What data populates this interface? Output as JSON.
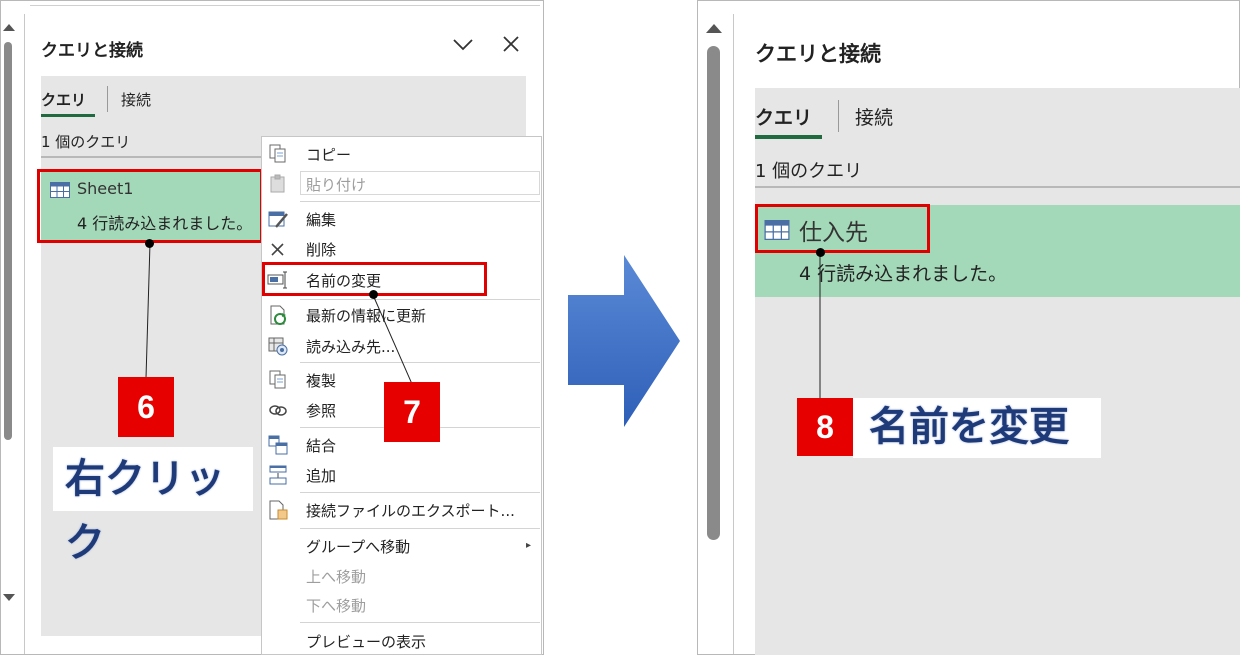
{
  "left_panel": {
    "title": "クエリと接続",
    "tabs": {
      "queries": "クエリ",
      "connections": "接続"
    },
    "query_count": "1 個のクエリ",
    "query": {
      "name": "Sheet1",
      "status": "4 行読み込まれました。"
    }
  },
  "context_menu": {
    "items": [
      {
        "label": "コピー",
        "icon": "copy-icon"
      },
      {
        "label": "貼り付け",
        "icon": "paste-icon",
        "disabled": true
      },
      {
        "label": "編集",
        "icon": "edit-icon"
      },
      {
        "label": "削除",
        "icon": "delete-icon"
      },
      {
        "label": "名前の変更",
        "icon": "rename-icon"
      },
      {
        "label": "最新の情報に更新",
        "icon": "refresh-icon"
      },
      {
        "label": "読み込み先...",
        "icon": "load-to-icon"
      },
      {
        "label": "複製",
        "icon": "duplicate-icon"
      },
      {
        "label": "参照",
        "icon": "reference-icon"
      },
      {
        "label": "結合",
        "icon": "merge-icon"
      },
      {
        "label": "追加",
        "icon": "append-icon"
      },
      {
        "label": "接続ファイルのエクスポート...",
        "icon": "export-icon"
      },
      {
        "label": "グループへ移動",
        "icon": ""
      },
      {
        "label": "上へ移動",
        "icon": "",
        "disabled": true
      },
      {
        "label": "下へ移動",
        "icon": "",
        "disabled": true
      },
      {
        "label": "プレビューの表示",
        "icon": ""
      }
    ]
  },
  "callouts": {
    "step6": "6",
    "step6_label": "右クリック",
    "step7": "7",
    "step8": "8",
    "step8_label": "名前を変更"
  },
  "right_panel": {
    "title": "クエリと接続",
    "tabs": {
      "queries": "クエリ",
      "connections": "接続"
    },
    "query_count": "1 個のクエリ",
    "query": {
      "name": "仕入先",
      "status": "4 行読み込まれました。"
    }
  },
  "colors": {
    "highlight_red": "#e00000",
    "selected_query_bg": "#a3d8b8",
    "tab_underline": "#1f6b3f",
    "arrow_blue": "#3b6fc4"
  }
}
